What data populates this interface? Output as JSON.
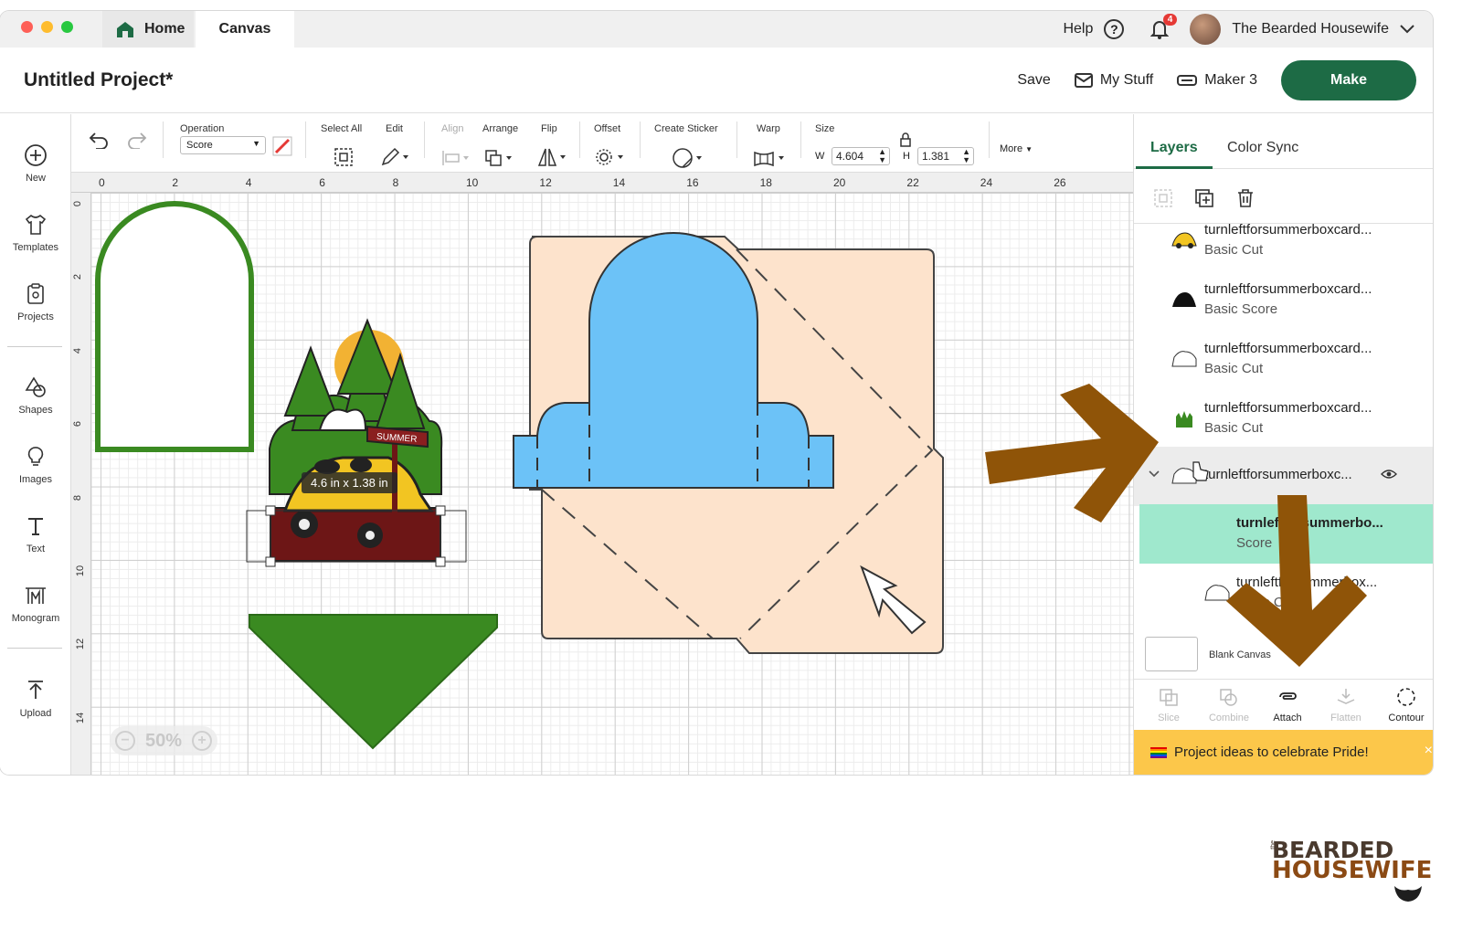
{
  "tabs": {
    "home": "Home",
    "canvas": "Canvas"
  },
  "account": {
    "help": "Help",
    "help_glyph": "?",
    "notifications": "4",
    "name": "The Bearded Housewife"
  },
  "header": {
    "title": "Untitled Project*",
    "save": "Save",
    "my_stuff": "My Stuff",
    "machine": "Maker 3",
    "make": "Make"
  },
  "leftnav": [
    {
      "label": "New",
      "icon": "plus-circle-icon"
    },
    {
      "label": "Templates",
      "icon": "shirt-icon"
    },
    {
      "label": "Projects",
      "icon": "projects-icon"
    },
    {
      "label": "Shapes",
      "icon": "shapes-icon"
    },
    {
      "label": "Images",
      "icon": "lightbulb-icon"
    },
    {
      "label": "Text",
      "icon": "text-icon"
    },
    {
      "label": "Monogram",
      "icon": "monogram-icon"
    },
    {
      "label": "Upload",
      "icon": "upload-icon"
    }
  ],
  "toolbar": {
    "operation_label": "Operation",
    "operation_value": "Score",
    "select_all": "Select All",
    "edit": "Edit",
    "align": "Align",
    "arrange": "Arrange",
    "flip": "Flip",
    "offset": "Offset",
    "create_sticker": "Create Sticker",
    "warp": "Warp",
    "size": "Size",
    "w_label": "W",
    "w_value": "4.604",
    "h_label": "H",
    "h_value": "1.381",
    "more": "More"
  },
  "ruler": {
    "h_ticks": [
      "0",
      "2",
      "4",
      "6",
      "8",
      "10",
      "12",
      "14",
      "16",
      "18",
      "20",
      "22",
      "24",
      "26"
    ],
    "v_ticks": [
      "0",
      "2",
      "4",
      "6",
      "8",
      "10",
      "12",
      "14"
    ]
  },
  "canvas": {
    "zoom": "50%",
    "size_tooltip": "4.6  in x 1.38  in",
    "sign_text": "SUMMER"
  },
  "panel": {
    "tab_layers": "Layers",
    "tab_colorsync": "Color Sync",
    "layers": [
      {
        "name": "turnleftforsummerboxcard...",
        "op": "Basic Cut",
        "thumb": "car-yellow"
      },
      {
        "name": "turnleftforsummerboxcard...",
        "op": "Basic Score",
        "thumb": "car-black"
      },
      {
        "name": "turnleftforsummerboxcard...",
        "op": "Basic Cut",
        "thumb": "outline"
      },
      {
        "name": "turnleftforsummerboxcard...",
        "op": "Basic Cut",
        "thumb": "grass"
      },
      {
        "name": "turnleftforsummerboxc...",
        "op": "",
        "thumb": "outline",
        "group": true
      },
      {
        "name": "turnleftforsummerbo...",
        "op": "Score",
        "thumb": "",
        "selected": true
      },
      {
        "name": "turnleftforsummerbox...",
        "op": "Basic Cut",
        "thumb": "outline"
      }
    ],
    "blank_canvas": "Blank Canvas",
    "bottom": {
      "slice": "Slice",
      "combine": "Combine",
      "attach": "Attach",
      "flatten": "Flatten",
      "contour": "Contour"
    },
    "banner": "Project ideas to celebrate Pride!",
    "banner_close": "×"
  },
  "brand": {
    "line1": "BEARDED",
    "line2": "HOUSEWIFE",
    "the": "the"
  },
  "colors": {
    "accent": "#1d6b45",
    "selected_layer": "#9fe8cd",
    "banner": "#fcc74a",
    "arrow": "#8f5408",
    "card": "#fde3cc",
    "tab_blue": "#6cc2f7",
    "green": "#3a8a21"
  }
}
